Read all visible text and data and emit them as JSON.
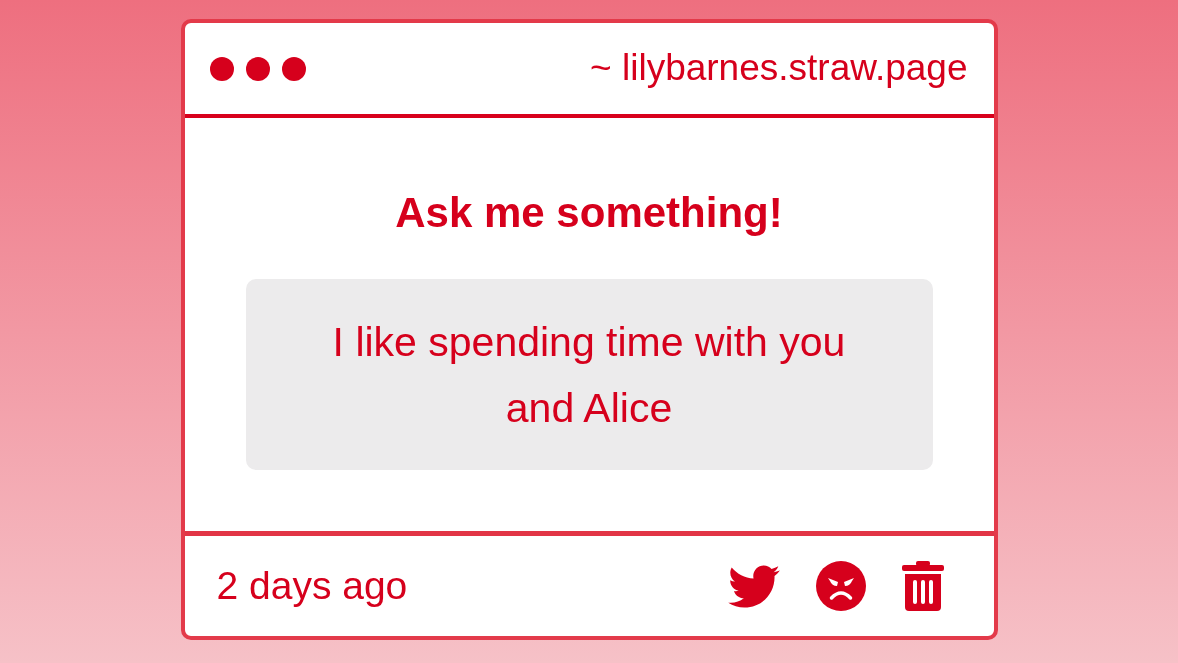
{
  "address_bar": {
    "url": "~ lilybarnes.straw.page"
  },
  "prompt": {
    "title": "Ask me something!"
  },
  "question": {
    "text": "I like spending time with you and Alice"
  },
  "footer": {
    "time": "2 days ago"
  }
}
